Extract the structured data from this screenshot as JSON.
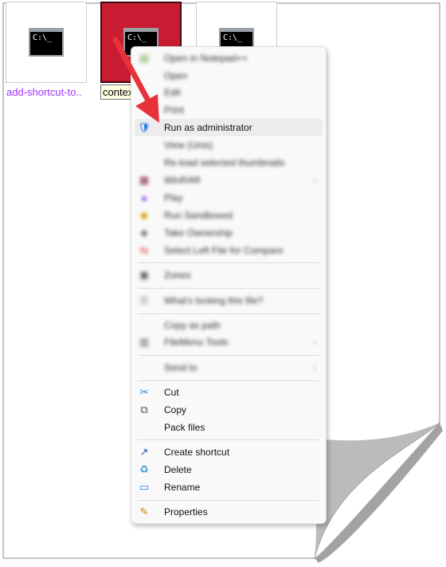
{
  "files": [
    {
      "name": "add-shortcut-to..",
      "icon": "cmd-icon",
      "glyph": "C:\\_"
    },
    {
      "name": "contex",
      "icon": "cmd-icon",
      "glyph": "C:\\_",
      "selected": true
    },
    {
      "name": "",
      "icon": "cmd-icon",
      "glyph": "C:\\_"
    }
  ],
  "menu": {
    "items": [
      {
        "label": "Open in Notepad++",
        "blurred": true,
        "icon": "notepad-icon"
      },
      {
        "label": "Open",
        "blurred": true
      },
      {
        "label": "Edit",
        "blurred": true
      },
      {
        "label": "Print",
        "blurred": true
      },
      {
        "label": "Run as administrator",
        "icon": "uac-shield-icon",
        "highlighted": true
      },
      {
        "label": "View (Unix)",
        "blurred": true
      },
      {
        "label": "Re-load selected thumbnails",
        "blurred": true
      },
      {
        "label": "WinRAR",
        "blurred": true,
        "submenu": true,
        "icon": "winrar-icon"
      },
      {
        "label": "Play",
        "blurred": true,
        "icon": "play-icon"
      },
      {
        "label": "Run Sandboxed",
        "blurred": true,
        "icon": "sandbox-icon"
      },
      {
        "label": "Take Ownership",
        "blurred": true,
        "icon": "ownership-icon"
      },
      {
        "label": "Select Left File for Compare",
        "blurred": true,
        "icon": "compare-icon"
      },
      {
        "label": "Zones",
        "blurred": true,
        "icon": "zones-icon"
      },
      {
        "label": "What's locking this file?",
        "blurred": true,
        "icon": "lock-icon"
      },
      {
        "label": "Copy as path",
        "blurred": true
      },
      {
        "label": "FileMenu Tools",
        "blurred": true,
        "submenu": true,
        "icon": "filemenu-icon"
      },
      {
        "label": "Send to",
        "blurred": true,
        "submenu": true
      },
      {
        "label": "Cut",
        "icon": "scissors-icon"
      },
      {
        "label": "Copy",
        "icon": "copy-icon"
      },
      {
        "label": "Pack files"
      },
      {
        "label": "Create shortcut",
        "icon": "shortcut-icon"
      },
      {
        "label": "Delete",
        "icon": "recycle-bin-icon"
      },
      {
        "label": "Rename",
        "icon": "rename-icon"
      },
      {
        "label": "Properties",
        "icon": "properties-icon"
      }
    ]
  },
  "colors": {
    "selected_tile": "#c81c33",
    "arrow": "#e8323a",
    "link": "#9b30ff"
  }
}
